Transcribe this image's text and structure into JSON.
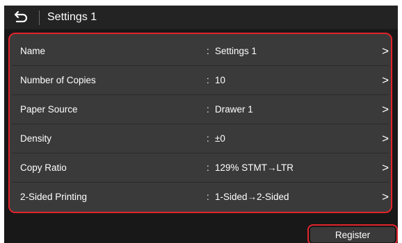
{
  "header": {
    "title": "Settings 1",
    "back_icon": "return-arrow-icon"
  },
  "settings": [
    {
      "label": "Name",
      "colon": ":",
      "value": "Settings 1",
      "chevron": ">"
    },
    {
      "label": "Number of Copies",
      "colon": ":",
      "value": "10",
      "chevron": ">"
    },
    {
      "label": "Paper Source",
      "colon": ":",
      "value": "Drawer 1",
      "chevron": ">"
    },
    {
      "label": "Density",
      "colon": ":",
      "value": "±0",
      "chevron": ">"
    },
    {
      "label": "Copy Ratio",
      "colon": ":",
      "value": "129% STMT→LTR",
      "chevron": ">"
    },
    {
      "label": "2-Sided Printing",
      "colon": ":",
      "value": "1-Sided→2-Sided",
      "chevron": ">"
    }
  ],
  "footer": {
    "register_label": "Register"
  },
  "colors": {
    "highlight": "#e3242b",
    "background": "#181818",
    "panel": "#3a3a3a",
    "text": "#ffffff"
  }
}
